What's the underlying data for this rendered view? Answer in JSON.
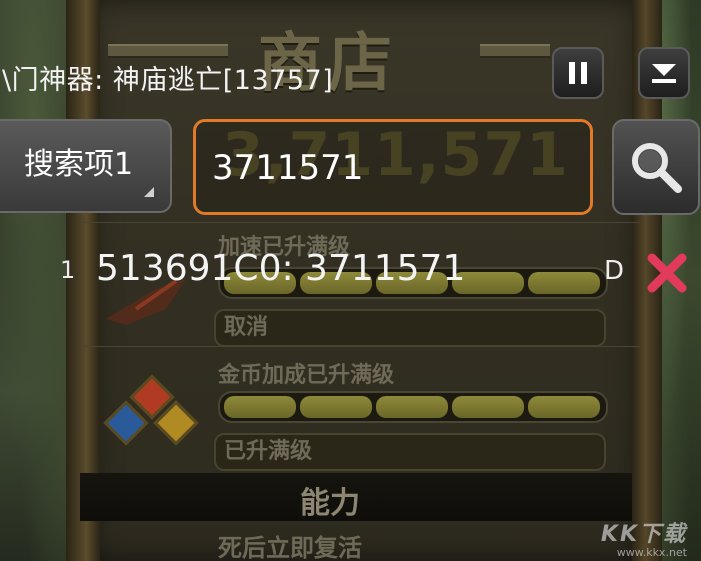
{
  "game": {
    "shop_title": "商店",
    "coin_display": "3,711,571",
    "items": [
      {
        "title": "加速已升满级",
        "button": "取消",
        "segments": 5
      },
      {
        "title": "金币加成已升满级",
        "button": "已升满级",
        "segments": 5
      }
    ],
    "section_label": "能力",
    "next_item_title": "死后立即复活"
  },
  "overlay": {
    "header_title": "\\门神器: 神庙逃亡[13757]",
    "search_type_label": "搜索项1",
    "search_value": "3711571",
    "results": [
      {
        "index": "1",
        "text": "513691C0: 3711571",
        "type": "D"
      }
    ]
  },
  "icons": {
    "pause": "pause-icon",
    "minimize": "minimize-icon",
    "search": "search-icon",
    "delete": "close-x-icon"
  },
  "colors": {
    "input_border": "#e07a2a",
    "delete": "#e23a5a"
  },
  "watermark": {
    "brand": "KK下载",
    "url": "www.kkx.net"
  }
}
